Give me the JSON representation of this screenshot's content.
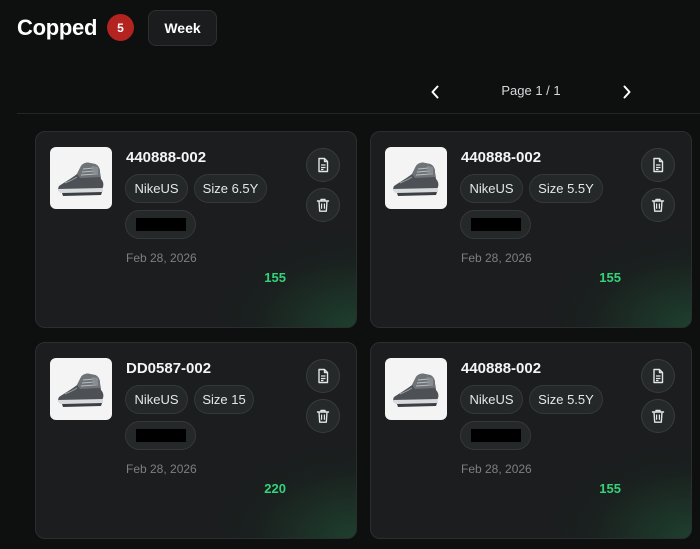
{
  "header": {
    "title": "Copped",
    "count_badge": "5",
    "period_button": "Week"
  },
  "pagination": {
    "label": "Page 1 / 1",
    "prev_icon": "chevron-left-icon",
    "next_icon": "chevron-right-icon"
  },
  "cards": [
    {
      "sku": "440888-002",
      "store": "NikeUS",
      "size": "Size 6.5Y",
      "date": "Feb 28, 2026",
      "price": "155"
    },
    {
      "sku": "440888-002",
      "store": "NikeUS",
      "size": "Size 5.5Y",
      "date": "Feb 28, 2026",
      "price": "155"
    },
    {
      "sku": "DD0587-002",
      "store": "NikeUS",
      "size": "Size 15",
      "date": "Feb 28, 2026",
      "price": "220"
    },
    {
      "sku": "440888-002",
      "store": "NikeUS",
      "size": "Size 5.5Y",
      "date": "Feb 28, 2026",
      "price": "155"
    }
  ],
  "card_icons": {
    "thumbnail": "sneaker-image",
    "doc": "document-icon",
    "trash": "trash-icon"
  },
  "colors": {
    "background": "#0e0f0f",
    "card": "#1b1d1e",
    "badge": "#b3231f",
    "price": "#36d27a",
    "card_glow": "#227848"
  }
}
